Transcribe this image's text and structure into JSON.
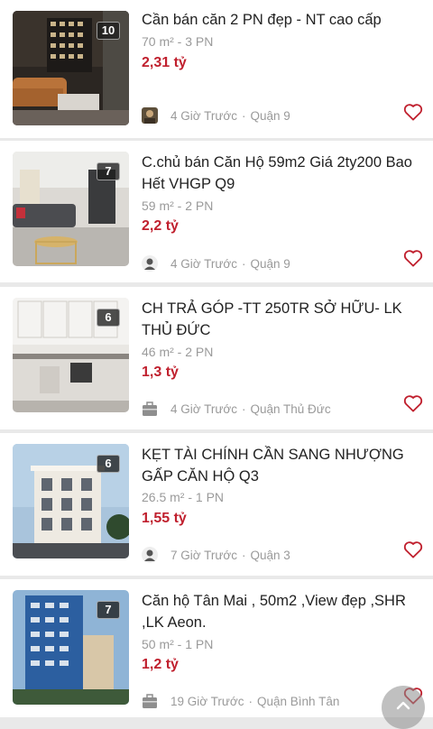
{
  "listings": [
    {
      "title": "Cần bán căn 2 PN đẹp - NT cao cấp",
      "spec": "70 m² - 3 PN",
      "price": "2,31 tỷ",
      "photo_count": "10",
      "time": "4 Giờ Trước",
      "district": "Quận 9",
      "avatar_icon": "user-photo-avatar"
    },
    {
      "title": "C.chủ bán Căn Hộ 59m2 Giá 2ty200 Bao Hết VHGP Q9",
      "spec": "59 m² - 2 PN",
      "price": "2,2 tỷ",
      "photo_count": "7",
      "time": "4 Giờ Trước",
      "district": "Quận 9",
      "avatar_icon": "default-avatar"
    },
    {
      "title": "CH TRẢ GÓP -TT 250TR SỞ HỮU- LK THỦ ĐỨC",
      "spec": "46 m² - 2 PN",
      "price": "1,3 tỷ",
      "photo_count": "6",
      "time": "4 Giờ Trước",
      "district": "Quận Thủ Đức",
      "avatar_icon": "shop-icon"
    },
    {
      "title": "KẸT TÀI CHÍNH CẦN SANG NHƯỢNG GẤP CĂN HỘ Q3",
      "spec": "26.5 m² - 1 PN",
      "price": "1,55 tỷ",
      "photo_count": "6",
      "time": "7 Giờ Trước",
      "district": "Quận 3",
      "avatar_icon": "default-avatar"
    },
    {
      "title": "Căn hộ Tân Mai , 50m2 ,View đẹp ,SHR ,LK Aeon.",
      "spec": "50 m² - 1 PN",
      "price": "1,2 tỷ",
      "photo_count": "7",
      "time": "19 Giờ Trước",
      "district": "Quận Bình Tân",
      "avatar_icon": "shop-icon"
    }
  ],
  "colors": {
    "price": "#c0202e",
    "heart": "#c0202e",
    "muted_text": "#9a9a9a",
    "separator": "#e9e9e9"
  }
}
